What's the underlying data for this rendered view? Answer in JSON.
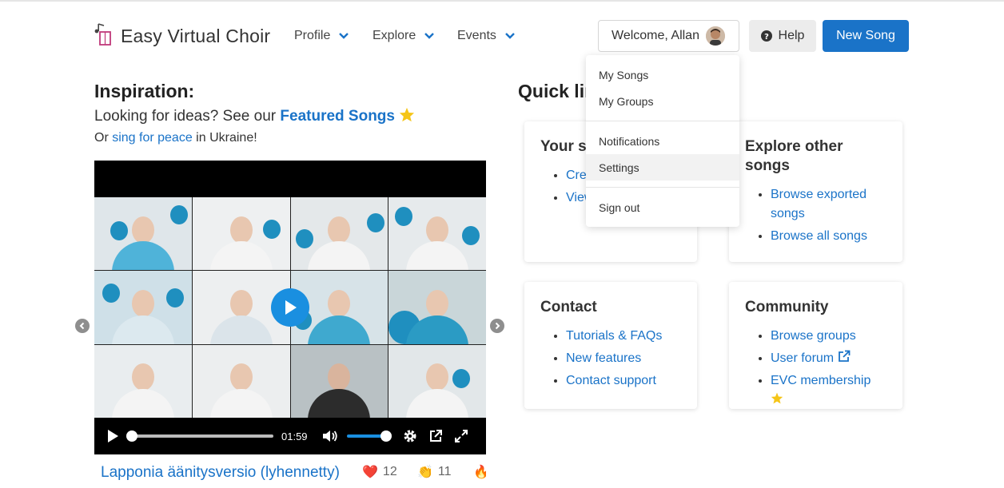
{
  "brand": {
    "name": "Easy Virtual Choir",
    "logo_icon": "music-note-book-icon"
  },
  "nav": {
    "items": [
      {
        "label": "Profile"
      },
      {
        "label": "Explore"
      },
      {
        "label": "Events"
      }
    ]
  },
  "header": {
    "welcome": "Welcome, Allan",
    "help": "Help",
    "new_song": "New Song"
  },
  "user_menu": {
    "items": [
      "My Songs",
      "My Groups",
      "Notifications",
      "Settings",
      "Sign out"
    ],
    "highlighted": "Settings"
  },
  "inspiration": {
    "title": "Inspiration:",
    "line1_prefix": "Looking for ideas? See our ",
    "featured_link": "Featured Songs",
    "line2_prefix": "Or ",
    "peace_link": "sing for peace",
    "line2_suffix": " in Ukraine!"
  },
  "video": {
    "time": "01:59",
    "progress": 0,
    "volume": 1.0,
    "song_title": "Lapponia äänitysversio (lyhennetty)",
    "reactions": [
      {
        "emoji": "❤️",
        "count": "12"
      },
      {
        "emoji": "👏",
        "count": "11"
      },
      {
        "emoji": "🔥",
        "count": ""
      }
    ]
  },
  "quick_links": {
    "title": "Quick links",
    "your_songs": {
      "title": "Your songs",
      "items": [
        "Create a new song",
        "View your songs"
      ]
    },
    "explore": {
      "title": "Explore other songs",
      "items": [
        "Browse exported songs",
        "Browse all songs"
      ]
    },
    "contact": {
      "title": "Contact",
      "items": [
        "Tutorials & FAQs",
        "New features",
        "Contact support"
      ]
    },
    "community": {
      "title": "Community",
      "items": [
        "Browse groups",
        "User forum",
        "EVC membership"
      ]
    }
  },
  "colors": {
    "accent": "#1a73c8",
    "star": "#f5c518",
    "video_play": "#1a8fe0"
  }
}
